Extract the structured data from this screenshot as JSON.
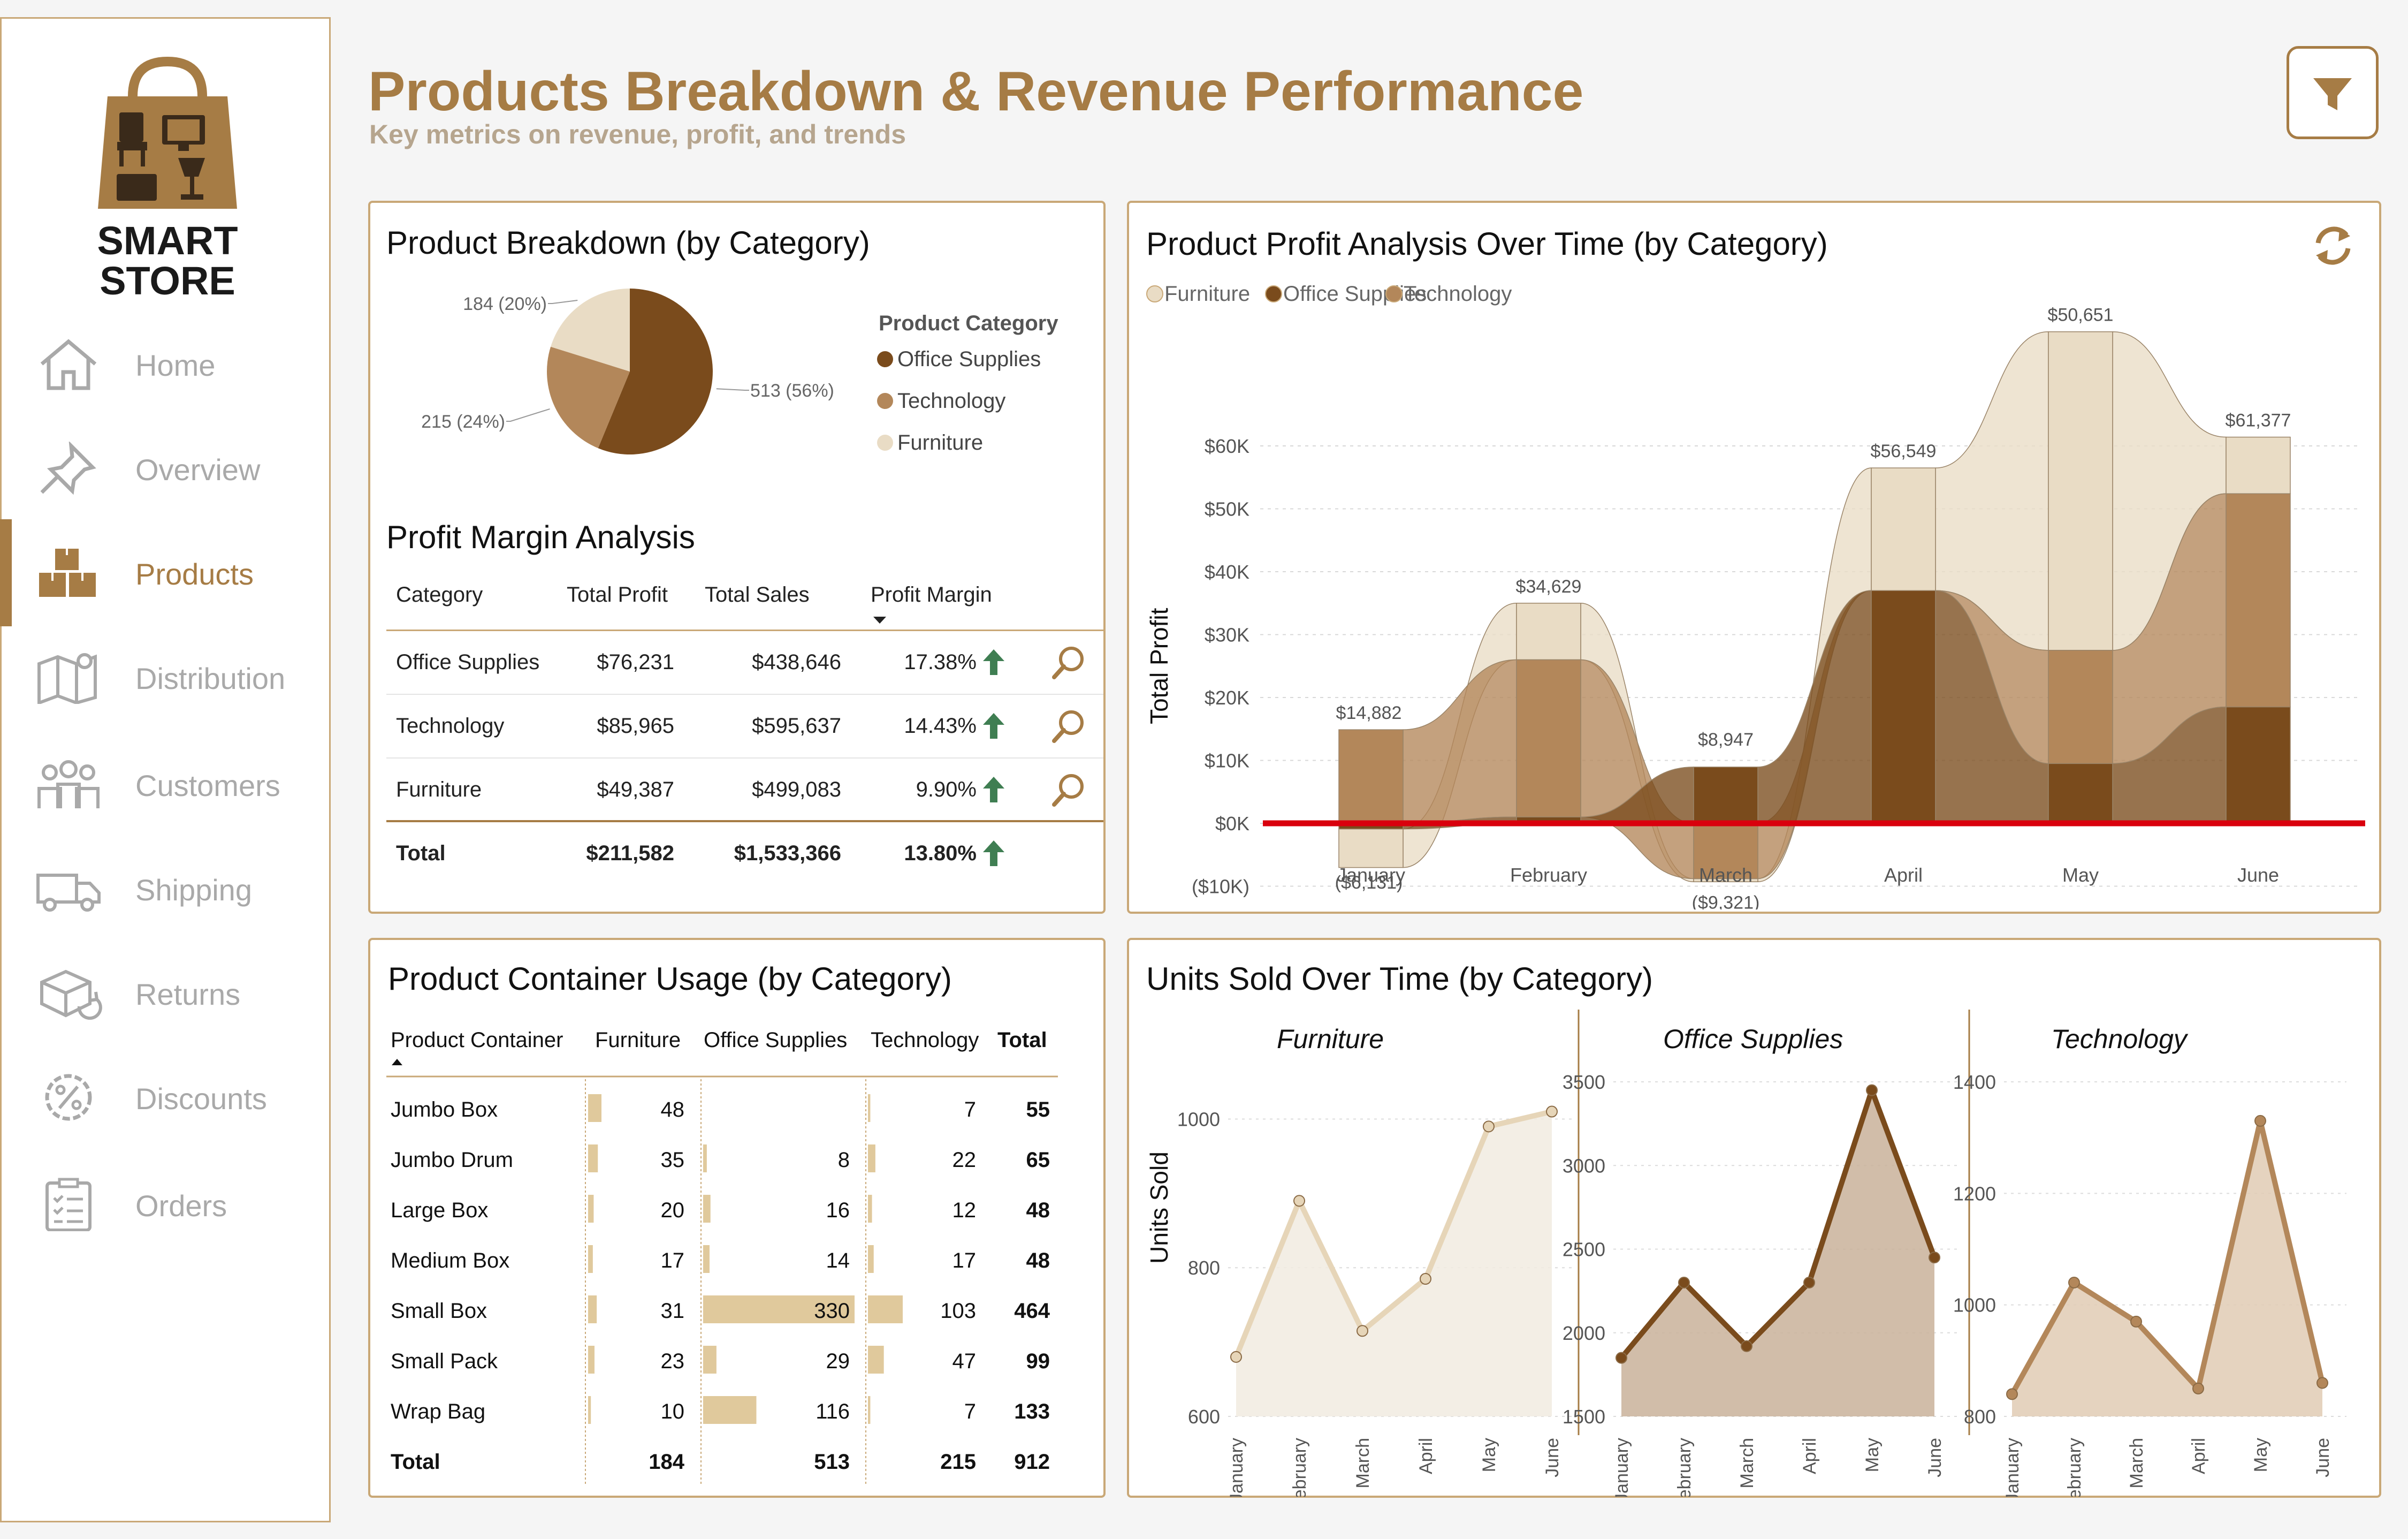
{
  "brand": {
    "line1": "SMART",
    "line2": "STORE"
  },
  "nav": {
    "items": [
      {
        "label": "Home",
        "icon": "home-icon"
      },
      {
        "label": "Overview",
        "icon": "pin-icon"
      },
      {
        "label": "Products",
        "icon": "boxes-icon",
        "active": true
      },
      {
        "label": "Distribution",
        "icon": "map-icon"
      },
      {
        "label": "Customers",
        "icon": "people-icon"
      },
      {
        "label": "Shipping",
        "icon": "truck-icon"
      },
      {
        "label": "Returns",
        "icon": "return-box-icon"
      },
      {
        "label": "Discounts",
        "icon": "percent-gear-icon"
      },
      {
        "label": "Orders",
        "icon": "clipboard-icon"
      }
    ]
  },
  "header": {
    "title": "Products Breakdown & Revenue Performance",
    "subtitle": "Key metrics on revenue, profit, and trends"
  },
  "colors": {
    "accent": "#a67c45",
    "office_supplies": "#7a4b1c",
    "technology": "#b3875a",
    "furniture": "#e9dcc5",
    "red_line": "#d9000d"
  },
  "breakdown": {
    "title": "Product Breakdown (by Category)",
    "legend_title": "Product Category",
    "chart_data": {
      "type": "pie",
      "labels": [
        "Office Supplies",
        "Technology",
        "Furniture"
      ],
      "values": [
        513,
        215,
        184
      ],
      "percents": [
        56,
        24,
        20
      ],
      "data_labels": [
        "513 (56%)",
        "215 (24%)",
        "184 (20%)"
      ]
    }
  },
  "margin": {
    "title": "Profit Margin Analysis",
    "columns": [
      "Category",
      "Total Profit",
      "Total Sales",
      "Profit Margin"
    ],
    "rows": [
      {
        "category": "Office Supplies",
        "profit": "$76,231",
        "sales": "$438,646",
        "margin": "17.38%"
      },
      {
        "category": "Technology",
        "profit": "$85,965",
        "sales": "$595,637",
        "margin": "14.43%"
      },
      {
        "category": "Furniture",
        "profit": "$49,387",
        "sales": "$499,083",
        "margin": "9.90%"
      }
    ],
    "total": {
      "label": "Total",
      "profit": "$211,582",
      "sales": "$1,533,366",
      "margin": "13.80%"
    }
  },
  "profit_chart": {
    "title": "Product Profit Analysis Over Time (by Category)",
    "legend": [
      "Furniture",
      "Office Supplies",
      "Technology"
    ],
    "chart_data": {
      "type": "area",
      "categories": [
        "January",
        "February",
        "March",
        "April",
        "May",
        "June"
      ],
      "ylabel": "Total Profit",
      "y_ticks": [
        "($10K)",
        "$0K",
        "$10K",
        "$20K",
        "$30K",
        "$40K",
        "$50K",
        "$60K"
      ],
      "ylim": [
        -10000,
        60000
      ],
      "totals_labels": [
        "$14,882",
        "$34,629",
        "$8,947",
        "$56,549",
        "$50,651",
        "$61,377"
      ],
      "negative_labels": [
        "($6,131)",
        "",
        "($9,321)",
        "",
        "",
        ""
      ],
      "series": [
        {
          "name": "Furniture",
          "values": [
            -6131,
            9000,
            -500,
            19500,
            50651,
            9000
          ]
        },
        {
          "name": "Office Supplies",
          "values": [
            -900,
            1000,
            8947,
            37000,
            9500,
            18500
          ]
        },
        {
          "name": "Technology",
          "values": [
            14882,
            25000,
            -8800,
            0,
            18000,
            33900
          ]
        }
      ]
    }
  },
  "containers": {
    "title": "Product Container Usage (by Category)",
    "columns": [
      "Product Container",
      "Furniture",
      "Office Supplies",
      "Technology",
      "Total"
    ],
    "rows": [
      {
        "name": "Jumbo Box",
        "f": "48",
        "o": "",
        "t": "7",
        "total": "55"
      },
      {
        "name": "Jumbo Drum",
        "f": "35",
        "o": "8",
        "t": "22",
        "total": "65"
      },
      {
        "name": "Large Box",
        "f": "20",
        "o": "16",
        "t": "12",
        "total": "48"
      },
      {
        "name": "Medium Box",
        "f": "17",
        "o": "14",
        "t": "17",
        "total": "48"
      },
      {
        "name": "Small Box",
        "f": "31",
        "o": "330",
        "t": "103",
        "total": "464"
      },
      {
        "name": "Small Pack",
        "f": "23",
        "o": "29",
        "t": "47",
        "total": "99"
      },
      {
        "name": "Wrap Bag",
        "f": "10",
        "o": "116",
        "t": "7",
        "total": "133"
      }
    ],
    "total": {
      "name": "Total",
      "f": "184",
      "o": "513",
      "t": "215",
      "total": "912"
    }
  },
  "units": {
    "title": "Units Sold Over Time (by Category)",
    "ylabel": "Units Sold",
    "chart_data": [
      {
        "type": "area",
        "title": "Furniture",
        "x": [
          "January",
          "February",
          "March",
          "April",
          "May",
          "June"
        ],
        "values": [
          680,
          890,
          715,
          785,
          990,
          1010
        ],
        "yticks": [
          "600",
          "800",
          "1000"
        ],
        "ylim": [
          600,
          1050
        ]
      },
      {
        "type": "area",
        "title": "Office Supplies",
        "x": [
          "January",
          "February",
          "March",
          "April",
          "May",
          "June"
        ],
        "values": [
          1850,
          2300,
          1920,
          2300,
          3450,
          2450
        ],
        "yticks": [
          "1500",
          "2000",
          "2500",
          "3000",
          "3500"
        ],
        "ylim": [
          1500,
          3500
        ]
      },
      {
        "type": "area",
        "title": "Technology",
        "x": [
          "January",
          "February",
          "March",
          "April",
          "May",
          "June"
        ],
        "values": [
          840,
          1040,
          970,
          850,
          1330,
          860
        ],
        "yticks": [
          "800",
          "1000",
          "1200",
          "1400"
        ],
        "ylim": [
          800,
          1400
        ]
      }
    ]
  }
}
